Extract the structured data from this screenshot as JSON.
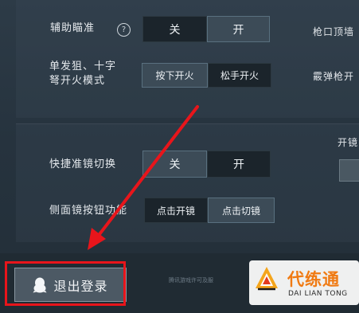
{
  "settings": {
    "aim_assist": {
      "label": "辅助瞄准",
      "help_icon": "question-circle-icon",
      "options": [
        "关",
        "开"
      ],
      "selected": "开"
    },
    "single_shot_fire": {
      "label_line1": "单发狙、十字",
      "label_line2": "弩开火模式",
      "options": [
        "按下开火",
        "松手开火"
      ],
      "selected": "按下开火"
    },
    "quick_scope_switch": {
      "label": "快捷准镜切换",
      "options": [
        "关",
        "开"
      ],
      "selected": "关"
    },
    "side_scope_button": {
      "label": "侧面镜按钮功能",
      "options": [
        "点击开镜",
        "点击切镜"
      ],
      "selected": "点击切镜"
    },
    "right_column": {
      "muzzle_label": "枪口顶墙",
      "shotgun_label": "霰弹枪开",
      "scope_label": "开镜"
    }
  },
  "footer": {
    "logout_label": "退出登录",
    "logout_icon": "penguin-icon",
    "notice_text": "腾讯游戏许可及服"
  },
  "watermark": {
    "title": "代练通",
    "subtitle": "DAI LIAN TONG",
    "logo_icon": "daliantong-logo-icon"
  },
  "colors": {
    "annotation_red": "#e8151b",
    "watermark_orange": "#f07a12"
  }
}
